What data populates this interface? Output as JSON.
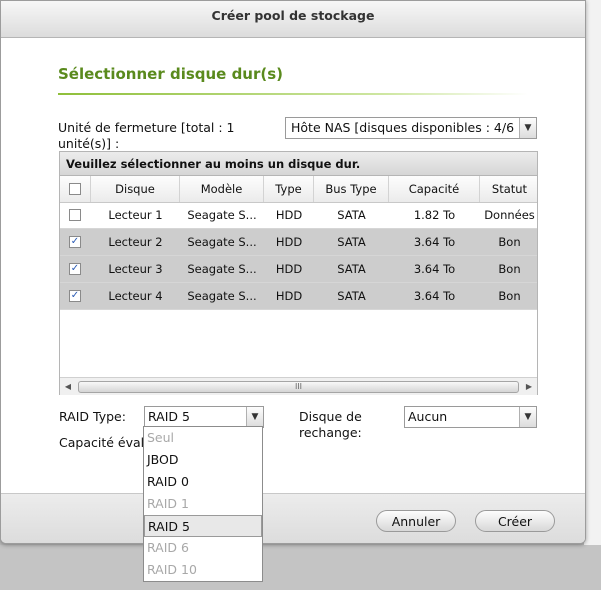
{
  "dialog": {
    "title": "Créer pool de stockage",
    "section_title": "Sélectionner disque dur(s)"
  },
  "enclosure": {
    "label": "Unité de fermeture [total : 1 unité(s)] :",
    "selected": "Hôte NAS [disques disponibles : 4/6"
  },
  "grid": {
    "notice": "Veuillez sélectionner au moins un disque dur.",
    "columns": [
      "Disque",
      "Modèle",
      "Type",
      "Bus Type",
      "Capacité",
      "Statut"
    ],
    "rows": [
      {
        "checked": false,
        "disk": "Lecteur 1",
        "model": "Seagate S...",
        "type": "HDD",
        "bus": "SATA",
        "capacity": "1.82 To",
        "status": "Données"
      },
      {
        "checked": true,
        "disk": "Lecteur 2",
        "model": "Seagate S...",
        "type": "HDD",
        "bus": "SATA",
        "capacity": "3.64 To",
        "status": "Bon"
      },
      {
        "checked": true,
        "disk": "Lecteur 3",
        "model": "Seagate S...",
        "type": "HDD",
        "bus": "SATA",
        "capacity": "3.64 To",
        "status": "Bon"
      },
      {
        "checked": true,
        "disk": "Lecteur 4",
        "model": "Seagate S...",
        "type": "HDD",
        "bus": "SATA",
        "capacity": "3.64 To",
        "status": "Bon"
      }
    ],
    "scroll_grip": "III"
  },
  "raid": {
    "label": "RAID Type:",
    "selected": "RAID 5",
    "options": [
      {
        "label": "Seul",
        "enabled": false
      },
      {
        "label": "JBOD",
        "enabled": true
      },
      {
        "label": "RAID 0",
        "enabled": true
      },
      {
        "label": "RAID 1",
        "enabled": false
      },
      {
        "label": "RAID 5",
        "enabled": true,
        "highlighted": true
      },
      {
        "label": "RAID 6",
        "enabled": false
      },
      {
        "label": "RAID 10",
        "enabled": false
      }
    ]
  },
  "spare": {
    "label": "Disque de rechange:",
    "selected": "Aucun"
  },
  "capacity": {
    "label": "Capacité éval"
  },
  "buttons": {
    "cancel": "Annuler",
    "create": "Créer"
  },
  "colors": {
    "accent": "#5a8a1d",
    "selected_row": "#cdcdcd"
  }
}
